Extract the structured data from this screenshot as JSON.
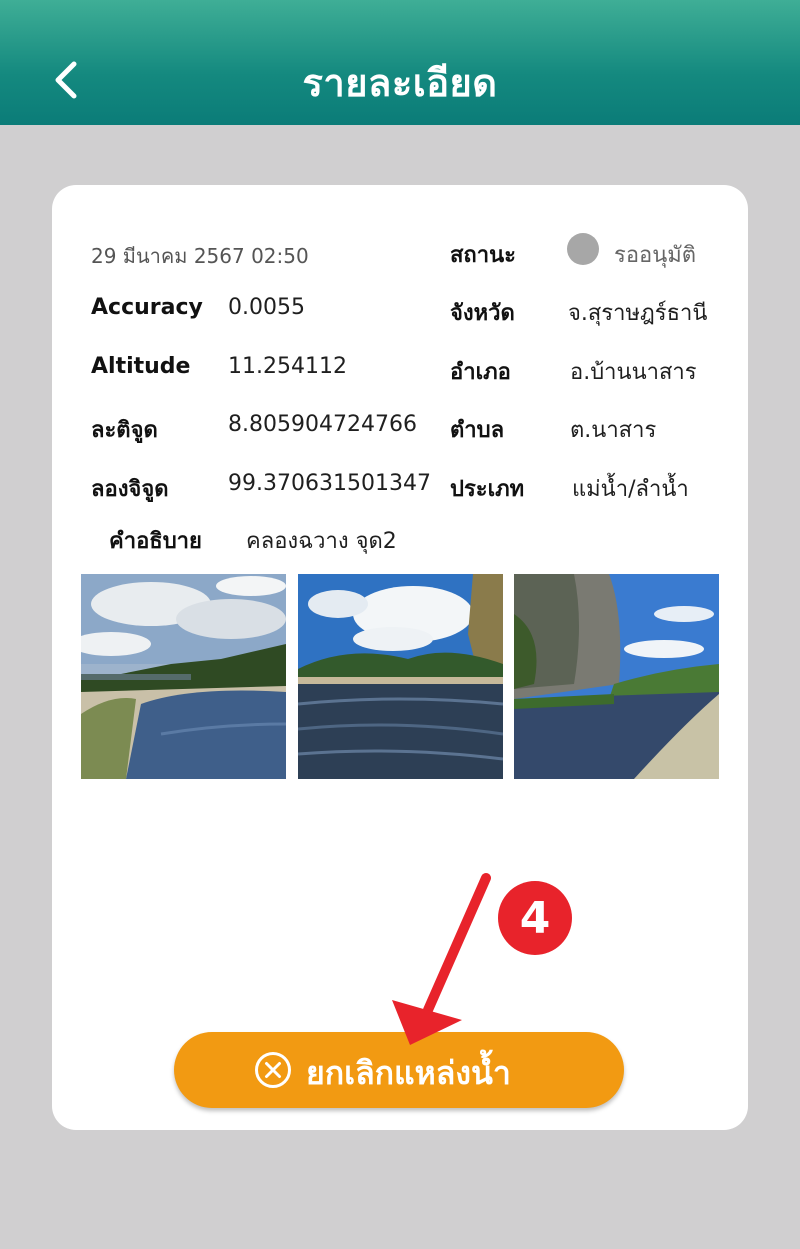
{
  "header": {
    "title": "รายละเอียด",
    "back_icon": "chevron-left-icon"
  },
  "details": {
    "datetime": "29 มีนาคม 2567   02:50",
    "status_label": "สถานะ",
    "status_value": "รออนุมัติ",
    "status_color": "#a7a7a7",
    "accuracy_label": "Accuracy",
    "accuracy_value": "0.0055",
    "province_label": "จังหวัด",
    "province_value": "จ.สุราษฎร์ธานี",
    "altitude_label": "Altitude",
    "altitude_value": "11.254112",
    "district_label": "อำเภอ",
    "district_value": "อ.บ้านนาสาร",
    "latitude_label": "ละติจูด",
    "latitude_value": "8.805904724766",
    "subdistrict_label": "ตำบล",
    "subdistrict_value": "ต.นาสาร",
    "longitude_label": "ลองจิจูด",
    "longitude_value": "99.370631501347",
    "type_label": "ประเภท",
    "type_value": "แม่น้ำ/ลำน้ำ",
    "description_label": "คำอธิบาย",
    "description_value": "คลองฉวาง จุด2"
  },
  "photos": [
    "river-photo-1",
    "river-photo-2",
    "river-photo-3"
  ],
  "action": {
    "cancel_label": "ยกเลิกแหล่งน้ำ",
    "cancel_icon": "circle-x-icon"
  },
  "annotation": {
    "step": "4",
    "color": "#e8232b"
  },
  "colors": {
    "header": "#14897f",
    "accent": "#f29a12",
    "background": "#d0cfd0"
  }
}
